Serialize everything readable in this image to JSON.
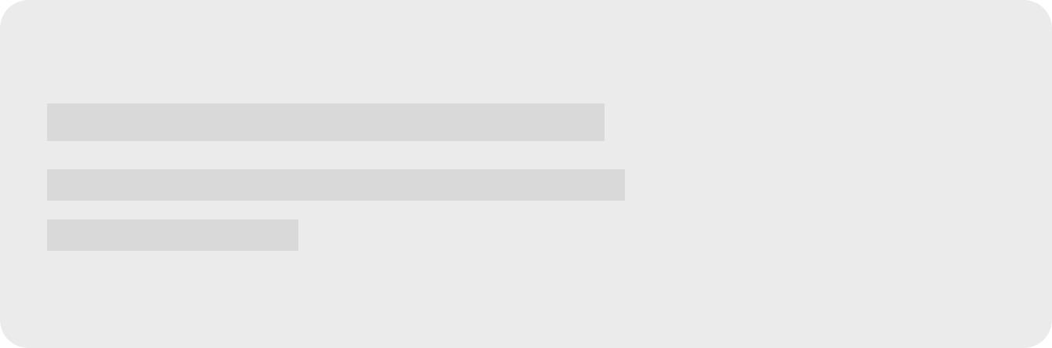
{
  "card": {
    "state": "loading",
    "colors": {
      "background": "#ebebeb",
      "placeholder": "#d9d9d9"
    },
    "placeholder_lines": [
      {
        "role": "title"
      },
      {
        "role": "body"
      },
      {
        "role": "body"
      }
    ]
  }
}
